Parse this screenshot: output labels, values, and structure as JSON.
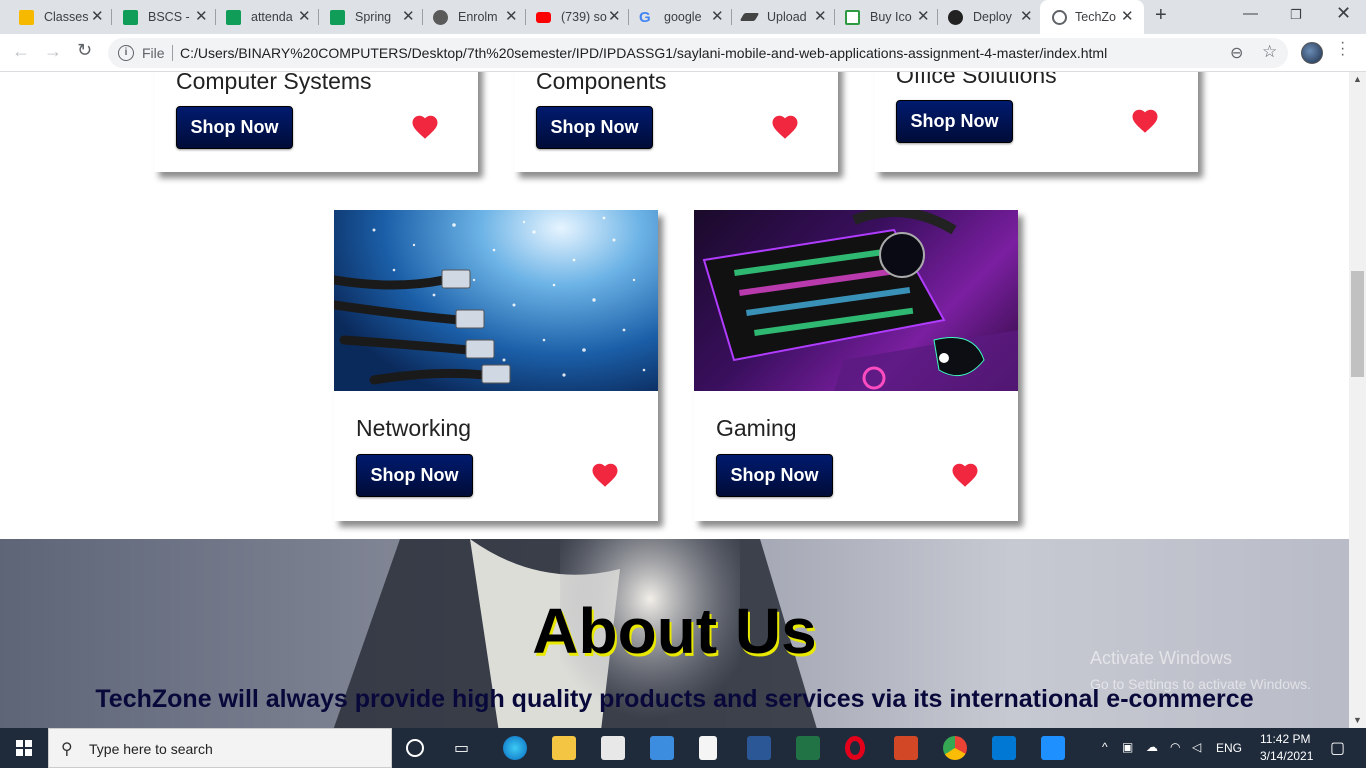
{
  "browser": {
    "tabs": [
      {
        "label": "Classes",
        "icon": "google-classroom-icon",
        "color": "#f6b900"
      },
      {
        "label": "BSCS -",
        "icon": "google-sheets-icon",
        "color": "#0f9d58"
      },
      {
        "label": "attenda",
        "icon": "google-sheets-icon",
        "color": "#0f9d58"
      },
      {
        "label": "Spring",
        "icon": "google-sheets-icon",
        "color": "#0f9d58"
      },
      {
        "label": "Enrolm",
        "icon": "university-icon",
        "color": "#5a5a5a"
      },
      {
        "label": "(739) so",
        "icon": "youtube-icon",
        "color": "#ff0000"
      },
      {
        "label": "google",
        "icon": "google-icon",
        "color": "#4285f4"
      },
      {
        "label": "Upload",
        "icon": "graduation-cap-icon",
        "color": "#444444"
      },
      {
        "label": "Buy Ico",
        "icon": "icon-store-icon",
        "color": "#2e9b43"
      },
      {
        "label": "Deploy",
        "icon": "github-icon",
        "color": "#222222"
      },
      {
        "label": "TechZo",
        "icon": "globe-icon",
        "color": "#5f6368"
      }
    ],
    "url_scheme": "File",
    "url": "C:/Users/BINARY%20COMPUTERS/Desktop/7th%20semester/IPD/IPDASSG1/saylani-mobile-and-web-applications-assignment-4-master/index.html"
  },
  "page": {
    "top_cards": [
      {
        "title": "Computer Systems",
        "button": "Shop Now"
      },
      {
        "title": "Components",
        "button": "Shop Now"
      },
      {
        "title": "Office Solutions",
        "button": "Shop Now"
      }
    ],
    "cards": [
      {
        "title": "Networking",
        "button": "Shop Now",
        "image": "fiber-optic-network-cables"
      },
      {
        "title": "Gaming",
        "button": "Shop Now",
        "image": "rgb-gaming-keyboard-headset"
      }
    ],
    "about": {
      "heading": "About Us",
      "text": "TechZone will always provide high quality products and services via its international e-commerce"
    },
    "watermark": {
      "line1": "Activate Windows",
      "line2": "Go to Settings to activate Windows."
    },
    "heart_color": "#f0273e",
    "button_color": "#001a6e"
  },
  "taskbar": {
    "search_placeholder": "Type here to search",
    "language": "ENG",
    "time": "11:42 PM",
    "date": "3/14/2021",
    "apps": [
      "cortana-icon",
      "task-view-icon",
      "edge-icon",
      "file-explorer-icon",
      "store-icon",
      "mail-icon",
      "notepad-icon",
      "word-icon",
      "excel-icon",
      "opera-icon",
      "office-icon",
      "chrome-icon",
      "vscode-icon",
      "photos-icon"
    ]
  }
}
